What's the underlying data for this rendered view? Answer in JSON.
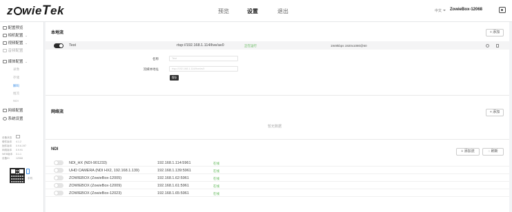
{
  "header": {
    "logo": "zowieTek",
    "nav": [
      "预览",
      "设置",
      "退出"
    ],
    "active_nav": "设置",
    "lang": "中文",
    "device_name": "ZowieBox-12068"
  },
  "sidebar": {
    "items": [
      {
        "label": "配置预览",
        "disabled": false
      },
      {
        "label": "相机配置",
        "disabled": false
      },
      {
        "label": "视频配置",
        "disabled": false
      },
      {
        "label": "音频配置",
        "disabled": true
      },
      {
        "label": "媒体配置",
        "disabled": false
      },
      {
        "label": "网络配置",
        "disabled": false
      },
      {
        "label": "系统设置",
        "disabled": false
      }
    ],
    "media_sub": [
      {
        "label": "录像",
        "active": false
      },
      {
        "label": "存储",
        "active": false
      },
      {
        "label": "解码",
        "active": true
      },
      {
        "label": "推流",
        "active": false
      },
      {
        "label": "NDI",
        "active": false
      }
    ],
    "info": [
      {
        "label": "设备状态",
        "value": ""
      },
      {
        "label": "硬件版本",
        "value": "4.1.2"
      },
      {
        "label": "固件版本",
        "value": "0.9.6.197"
      },
      {
        "label": "网络版本",
        "value": "0.9.91"
      },
      {
        "label": "WEB版本",
        "value": "3.1.1"
      },
      {
        "label": "设备ID",
        "value": "12068"
      }
    ],
    "phone_label": "手机"
  },
  "local_stream": {
    "title": "本地流",
    "add_label": "+ 添加",
    "row": {
      "enabled": true,
      "name": "Test",
      "url": "rtsp://192.168.1.114/live/av0",
      "status": "正在运行",
      "detail": "1949kbps 1920x1080@60"
    },
    "form": {
      "name_label": "名称",
      "name_placeholder": "Test",
      "url_label": "流媒体地址",
      "url_placeholder": "rtsp://192.168.1.114/live/av0",
      "save_label": "保存"
    }
  },
  "network_stream": {
    "title": "网络流",
    "add_label": "+ 添加",
    "empty_text": "暂无数据"
  },
  "ndi": {
    "title": "NDI",
    "add_label": "+ 添加流",
    "refresh_label": "◌ 刷新",
    "rows": [
      {
        "name": "NDI_HX (NDI-901233)",
        "address": "192.168.1.114:5961",
        "status": "在线"
      },
      {
        "name": "UHD CAMERA (NDI HX2, 192.168.1.139)",
        "address": "192.168.1.139:5961",
        "status": "在线"
      },
      {
        "name": "ZOWIEBOX (ZowieBox-12005)",
        "address": "192.168.1.62:5961",
        "status": "在线"
      },
      {
        "name": "ZOWIEBOX (ZowieBox-12009)",
        "address": "192.168.1.61:5961",
        "status": "在线"
      },
      {
        "name": "ZOWIEBOX (ZowieBox-12023)",
        "address": "192.168.1.65:5961",
        "status": "在线"
      }
    ]
  },
  "colors": {
    "accent": "#3a8ee6",
    "online": "#5ab552",
    "dark": "#2f2f2f"
  }
}
